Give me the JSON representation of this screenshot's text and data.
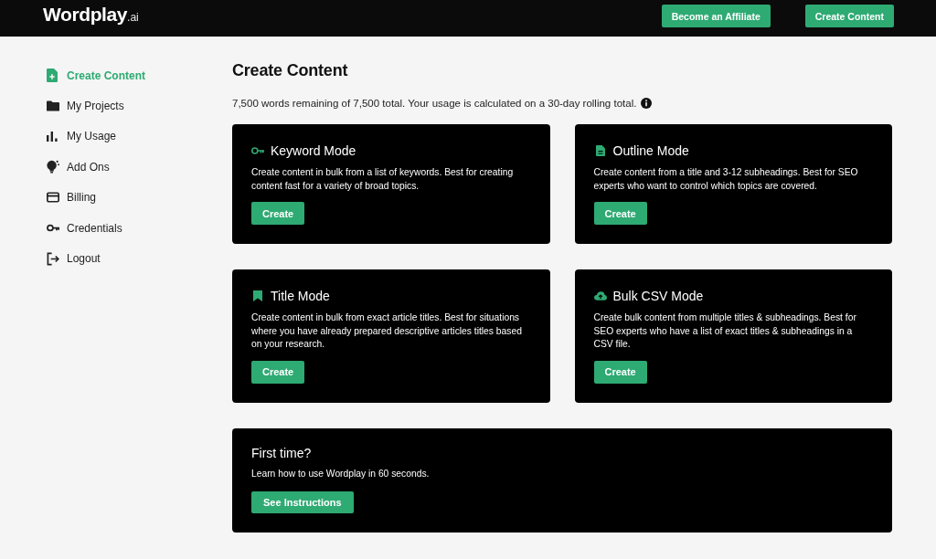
{
  "header": {
    "logo": {
      "name": "Wordplay",
      "suffix": ".ai"
    },
    "buttons": [
      "Become an Affiliate",
      "Create Content"
    ]
  },
  "sidebar": {
    "items": [
      {
        "label": "Create Content",
        "selected": true
      },
      {
        "label": "My Projects",
        "selected": false
      },
      {
        "label": "My Usage",
        "selected": false
      },
      {
        "label": "Add Ons",
        "selected": false
      },
      {
        "label": "Billing",
        "selected": false
      },
      {
        "label": "Credentials",
        "selected": false
      },
      {
        "label": "Logout",
        "selected": false
      }
    ]
  },
  "main": {
    "title": "Create Content",
    "usage_note": "7,500 words remaining of 7,500 total. Your usage is calculated on a 30-day rolling total.",
    "modes": [
      {
        "title": "Keyword Mode",
        "description": "Create content in bulk from a list of keywords. Best for creating content fast for a variety of broad topics.",
        "button": "Create"
      },
      {
        "title": "Outline Mode",
        "description": "Create content from a title and 3-12 subheadings. Best for SEO experts who want to control which topics are covered.",
        "button": "Create"
      },
      {
        "title": "Title Mode",
        "description": "Create content in bulk from exact article titles. Best for situations where you have already prepared descriptive articles titles based on your research.",
        "button": "Create"
      },
      {
        "title": "Bulk CSV Mode",
        "description": "Create bulk content from multiple titles & subheadings. Best for SEO experts who have a list of exact titles & subheadings in a CSV file.",
        "button": "Create"
      }
    ],
    "intro": {
      "title": "First time?",
      "text": "Learn how to use Wordplay in 60 seconds.",
      "button": "See Instructions"
    }
  }
}
